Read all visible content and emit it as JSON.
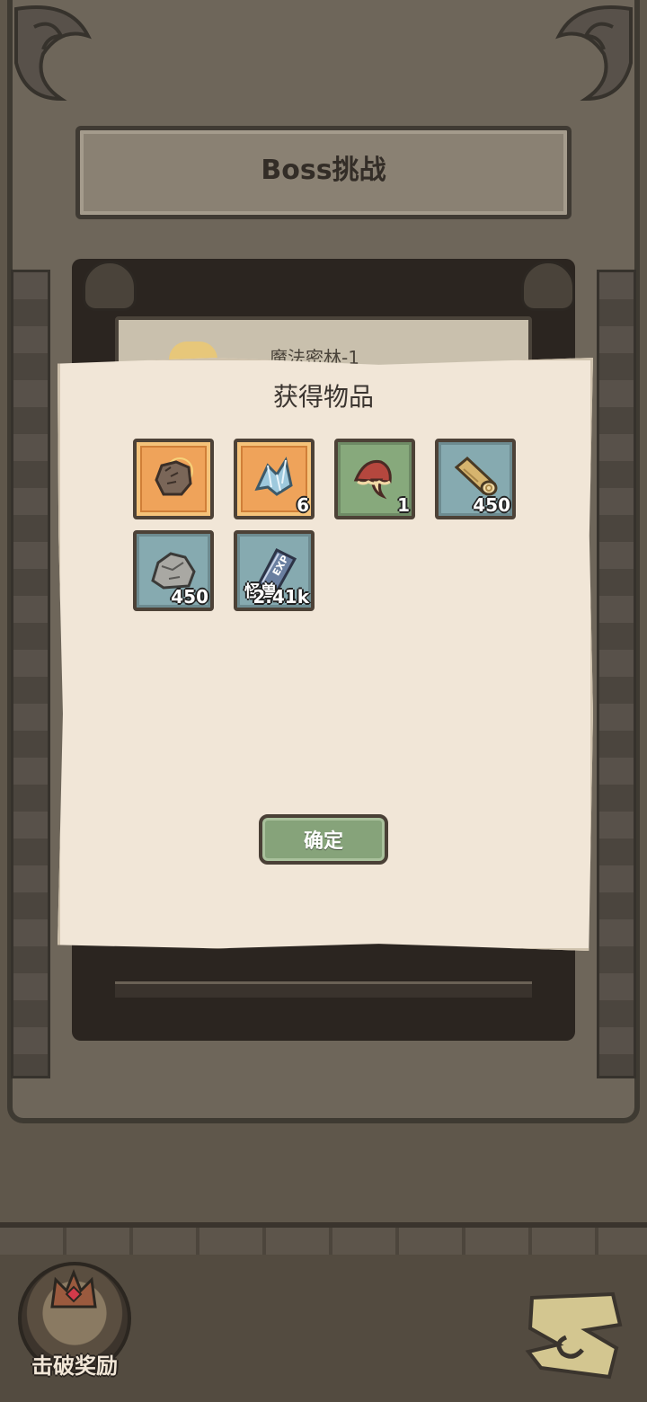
{
  "header": {
    "title": "Boss挑战"
  },
  "stage_card": {
    "label": "魔法密林-1"
  },
  "popup": {
    "title": "获得物品",
    "items": [
      {
        "icon": "glove-icon",
        "quantity": "",
        "frame": "orange"
      },
      {
        "icon": "crystal-shard-icon",
        "quantity": "6",
        "frame": "orange"
      },
      {
        "icon": "mushroom-icon",
        "quantity": "1",
        "frame": "green"
      },
      {
        "icon": "wood-log-icon",
        "quantity": "450",
        "frame": "teal"
      },
      {
        "icon": "stone-ore-icon",
        "quantity": "450",
        "frame": "teal"
      },
      {
        "icon": "exp-book-icon",
        "quantity": "2.41k",
        "sublabel": "怪兽",
        "frame": "teal"
      }
    ],
    "confirm_label": "确定"
  },
  "bottom": {
    "reward_label": "击破奖励"
  },
  "colors": {
    "paper": "#f1e6d7",
    "frame_orange": "#efa35a",
    "frame_green": "#87a97c",
    "frame_teal": "#86aab0",
    "confirm_button": "#86a37a"
  }
}
